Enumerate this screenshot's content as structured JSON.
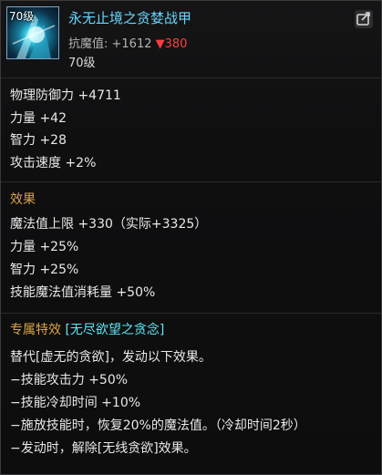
{
  "item": {
    "icon_level": "70级",
    "name": "永无止境之贪婪战甲",
    "resistance_label": "抗魔值: +1612",
    "resistance_delta": "▼380",
    "level": "70级"
  },
  "base_stats": [
    "物理防御力 +4711",
    "力量 +42",
    "智力 +28",
    "攻击速度 +2%"
  ],
  "effects": {
    "heading": "效果",
    "lines": [
      "魔法值上限 +330（实际+3325）",
      "力量 +25%",
      "智力 +25%",
      "技能魔法值消耗量 +50%"
    ]
  },
  "special": {
    "heading": "专属特效",
    "name": "[无尽欲望之贪念]",
    "lines": [
      "替代[虚无的贪欲]，发动以下效果。",
      "−技能攻击力 +50%",
      "−技能冷却时间 +10%",
      "−施放技能时，恢复20%的魔法值。（冷却时间2秒）",
      "−发动时，解除[无线贪欲]效果。"
    ]
  },
  "colors": {
    "item_name": "#68d7ff",
    "heading": "#d8a544",
    "special_name": "#5ee7f6",
    "delta_down": "#ff3d3d"
  },
  "icons": {
    "share": "share-icon",
    "item": "armor-item-icon"
  }
}
